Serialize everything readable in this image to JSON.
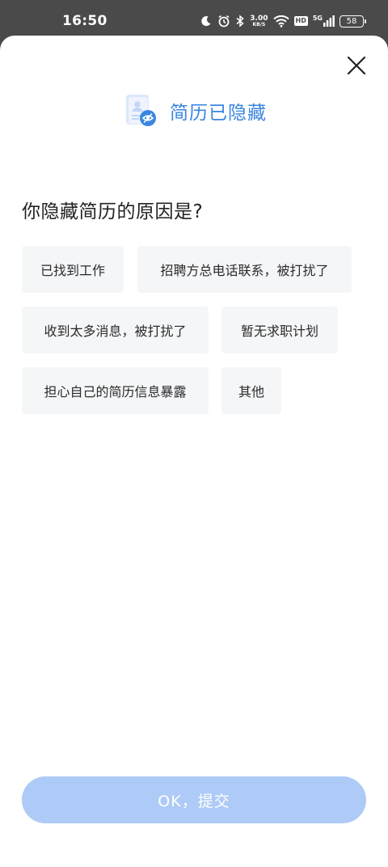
{
  "status_bar": {
    "time": "16:50",
    "net_speed_value": "3.00",
    "net_speed_unit": "KB/S",
    "hd_label": "HD",
    "network_type": "5G",
    "battery_level": "58"
  },
  "header": {
    "icon": "resume-hidden-icon",
    "title": "简历已隐藏"
  },
  "question": "你隐藏简历的原因是?",
  "reasons": [
    "已找到工作",
    "招聘方总电话联系，被打扰了",
    "收到太多消息，被打扰了",
    "暂无求职计划",
    "担心自己的简历信息暴露",
    "其他"
  ],
  "submit_label": "OK，提交",
  "colors": {
    "accent": "#3a86e0",
    "submit_disabled": "#aecbf7",
    "chip_bg": "#f5f6f8",
    "status_bar_bg": "#4a4a4a"
  }
}
